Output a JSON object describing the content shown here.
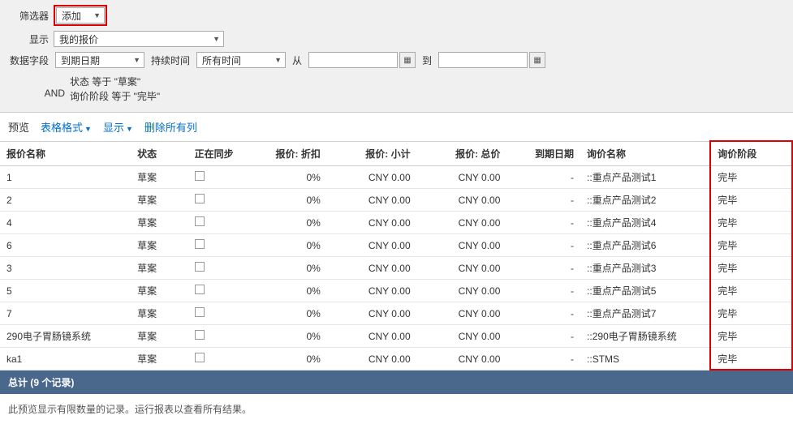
{
  "filters": {
    "filter_label": "筛选器",
    "add_label": "添加",
    "show_label": "显示",
    "show_value": "我的报价",
    "data_field_label": "数据字段",
    "data_field_value": "到期日期",
    "duration_label": "持续时间",
    "duration_value": "所有时间",
    "from_label": "从",
    "to_label": "到",
    "and_label": "AND",
    "cond1": "状态 等于 \"草案\"",
    "cond2": "询价阶段 等于 \"完毕\""
  },
  "preview_bar": {
    "preview": "预览",
    "table_format": "表格格式",
    "show": "显示",
    "clear_cols": "删除所有列"
  },
  "columns": {
    "name": "报价名称",
    "status": "状态",
    "sync": "正在同步",
    "discount": "报价: 折扣",
    "subtotal": "报价: 小计",
    "total": "报价: 总价",
    "due": "到期日期",
    "qname": "询价名称",
    "stage": "询价阶段"
  },
  "rows": [
    {
      "name": "1",
      "status": "草案",
      "discount": "0%",
      "subtotal": "CNY 0.00",
      "total": "CNY 0.00",
      "due": "-",
      "qname": "::重点产品测试1",
      "stage": "完毕"
    },
    {
      "name": "2",
      "status": "草案",
      "discount": "0%",
      "subtotal": "CNY 0.00",
      "total": "CNY 0.00",
      "due": "-",
      "qname": "::重点产品测试2",
      "stage": "完毕"
    },
    {
      "name": "4",
      "status": "草案",
      "discount": "0%",
      "subtotal": "CNY 0.00",
      "total": "CNY 0.00",
      "due": "-",
      "qname": "::重点产品测试4",
      "stage": "完毕"
    },
    {
      "name": "6",
      "status": "草案",
      "discount": "0%",
      "subtotal": "CNY 0.00",
      "total": "CNY 0.00",
      "due": "-",
      "qname": "::重点产品测试6",
      "stage": "完毕"
    },
    {
      "name": "3",
      "status": "草案",
      "discount": "0%",
      "subtotal": "CNY 0.00",
      "total": "CNY 0.00",
      "due": "-",
      "qname": "::重点产品测试3",
      "stage": "完毕"
    },
    {
      "name": "5",
      "status": "草案",
      "discount": "0%",
      "subtotal": "CNY 0.00",
      "total": "CNY 0.00",
      "due": "-",
      "qname": "::重点产品测试5",
      "stage": "完毕"
    },
    {
      "name": "7",
      "status": "草案",
      "discount": "0%",
      "subtotal": "CNY 0.00",
      "total": "CNY 0.00",
      "due": "-",
      "qname": "::重点产品测试7",
      "stage": "完毕"
    },
    {
      "name": "290电子胃肠镜系统",
      "status": "草案",
      "discount": "0%",
      "subtotal": "CNY 0.00",
      "total": "CNY 0.00",
      "due": "-",
      "qname": "::290电子胃肠镜系统",
      "stage": "完毕"
    },
    {
      "name": "ka1",
      "status": "草案",
      "discount": "0%",
      "subtotal": "CNY 0.00",
      "total": "CNY 0.00",
      "due": "-",
      "qname": "::STMS",
      "stage": "完毕"
    }
  ],
  "totals_label": "总计 (9 个记录)",
  "footer_note": "此预览显示有限数量的记录。运行报表以查看所有结果。"
}
